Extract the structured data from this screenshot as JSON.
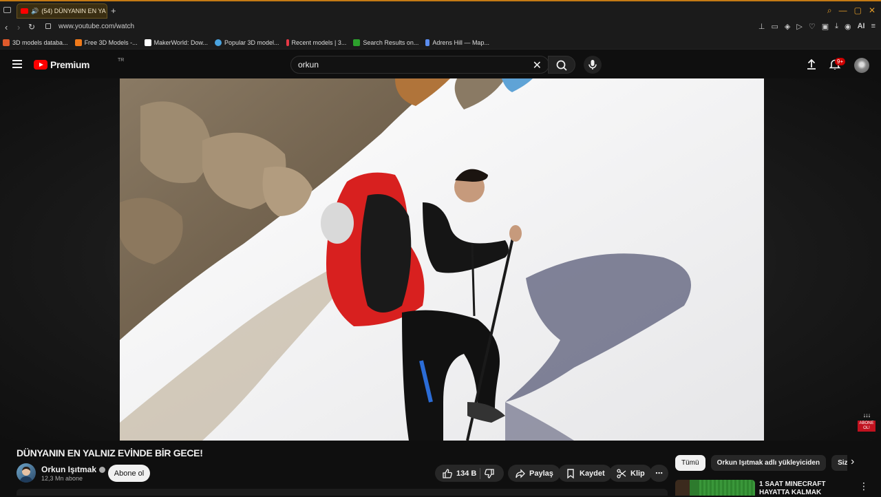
{
  "browser": {
    "tab_title": "(54) DÜNYANIN EN YA",
    "new_tab": "+",
    "url": "www.youtube.com/watch",
    "bookmarks": [
      {
        "label": "3D models databa...",
        "color": "#e05a2b"
      },
      {
        "label": "Free 3D Models -...",
        "color": "#f07a1a"
      },
      {
        "label": "MakerWorld: Dow...",
        "color": "#ffffff"
      },
      {
        "label": "Popular 3D model...",
        "color": "#4aa3df"
      },
      {
        "label": "Recent models | 3...",
        "color": "#e63946"
      },
      {
        "label": "Search Results on...",
        "color": "#2ca02c"
      },
      {
        "label": "Adrens Hill — Map...",
        "color": "#5b8def"
      }
    ],
    "ai_label": "AI"
  },
  "youtube": {
    "logo_word": "Premium",
    "logo_region": "TR",
    "search_value": "orkun",
    "notif_count": "9+",
    "accent": "#ff0000"
  },
  "video": {
    "title": "DÜNYANIN EN YALNIZ EVİNDE BİR GECE!",
    "overlay_abone": "ABONE OL!",
    "channel_name": "Orkun Işıtmak",
    "subscribers": "12,3 Mn abone",
    "subscribe_label": "Abone ol",
    "likes": "134 B",
    "share_label": "Paylaş",
    "save_label": "Kaydet",
    "clip_label": "Klip",
    "more_label": "⋯"
  },
  "sidebar": {
    "chips": [
      "Tümü",
      "Orkun Işıtmak adlı yükleyiciden",
      "Size ö"
    ],
    "recommendation_title": "1 SAAT MINECRAFT HAYATTA KALMAK"
  }
}
